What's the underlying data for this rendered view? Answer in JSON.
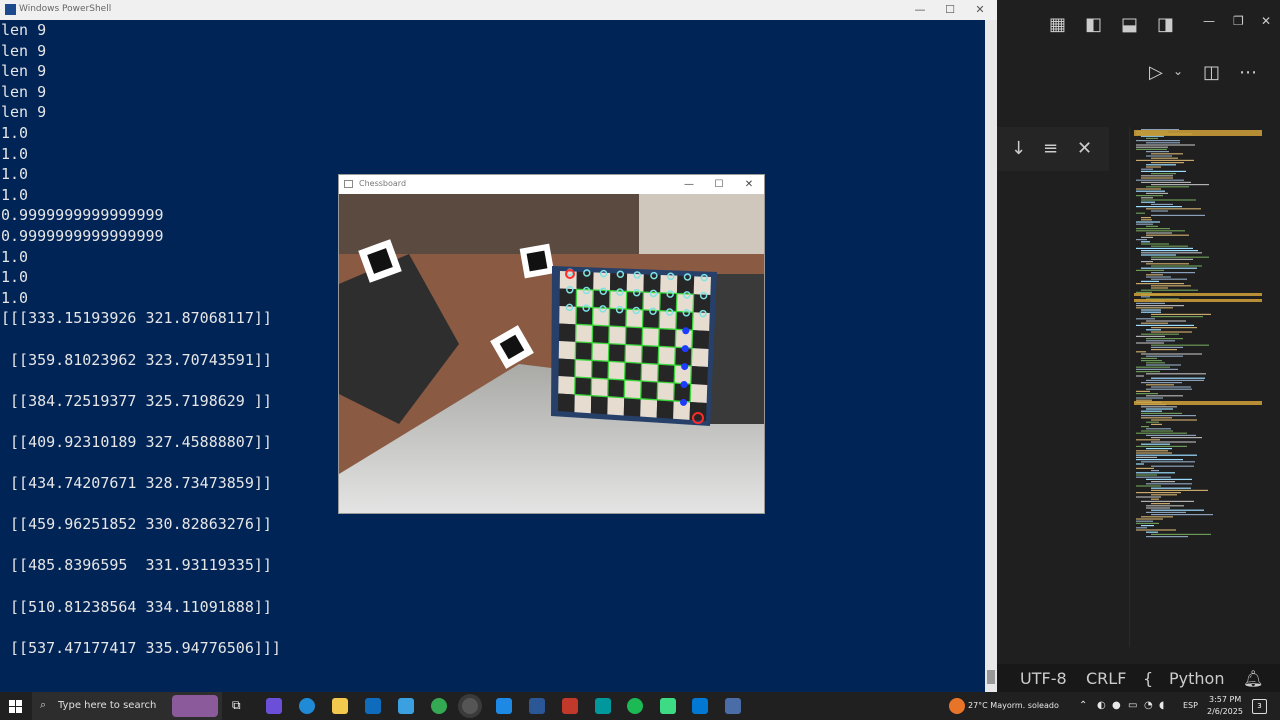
{
  "powershell": {
    "title": "Windows PowerShell",
    "lines": [
      "len 9",
      "len 9",
      "len 9",
      "len 9",
      "len 9",
      "1.0",
      "1.0",
      "1.0",
      "1.0",
      "0.9999999999999999",
      "0.9999999999999999",
      "1.0",
      "1.0",
      "1.0",
      "[[[333.15193926 321.87068117]]",
      "",
      " [[359.81023962 323.70743591]]",
      "",
      " [[384.72519377 325.7198629 ]]",
      "",
      " [[409.92310189 327.45888807]]",
      "",
      " [[434.74207671 328.73473859]]",
      "",
      " [[459.96251852 330.82863276]]",
      "",
      " [[485.8396595  331.93119335]]",
      "",
      " [[510.81238564 334.11091888]]",
      "",
      " [[537.47177417 335.94776506]]]"
    ]
  },
  "chessboard_window": {
    "title": "Chessboard"
  },
  "statusbar": {
    "encoding": "UTF-8",
    "eol": "CRLF",
    "language": "Python"
  },
  "taskbar": {
    "search_placeholder": "Type here to search",
    "weather": "27°C  Mayorm. soleado",
    "lang": "ESP",
    "time": "3:57 PM",
    "date": "2/6/2025",
    "notifications": "3"
  },
  "colors": {
    "ps_bg": "#012456",
    "editor_bg": "#1f1f1f",
    "taskbar_bg": "#202020"
  }
}
